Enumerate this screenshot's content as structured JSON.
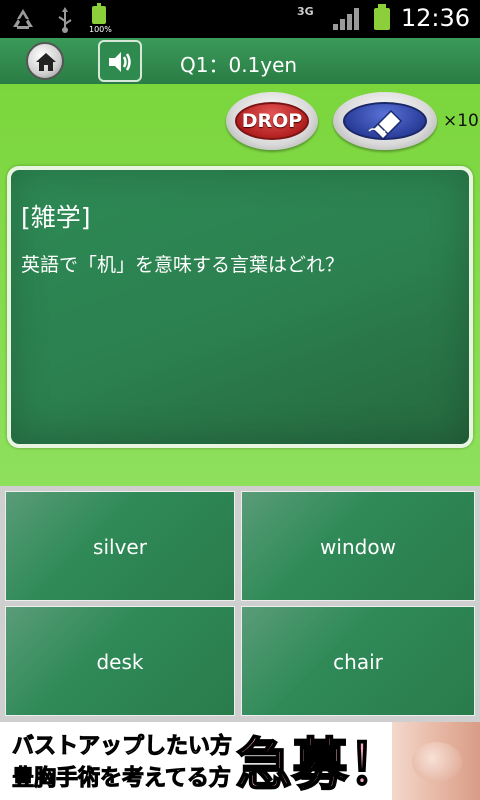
{
  "status_bar": {
    "battery_text": "100%",
    "network_text": "3G",
    "time": "12:36"
  },
  "header": {
    "question_label": "Q1：0.1yen"
  },
  "tools": {
    "drop_label": "DROP",
    "multiplier": "×10"
  },
  "question": {
    "category": "[雑学]",
    "text": "英語で「机」を意味する言葉はどれ？"
  },
  "answers": [
    "silver",
    "window",
    "desk",
    "chair"
  ],
  "ad": {
    "line1": "バストアップしたい方",
    "line2": "豊胸手術を考えてる方",
    "big_text": "急募！"
  },
  "colors": {
    "board": "#2c8150",
    "green_bg": "#84db4c",
    "drop_red": "#b32020",
    "eraser_blue": "#2a3e9a"
  }
}
